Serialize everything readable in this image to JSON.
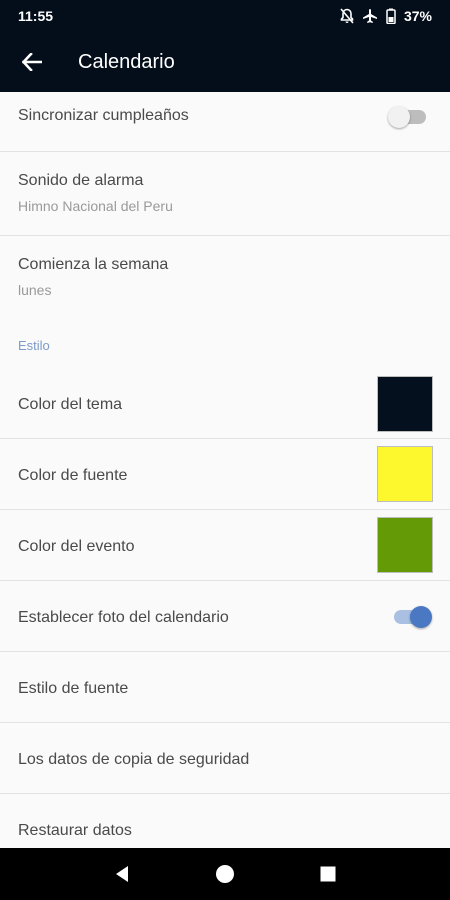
{
  "status_bar": {
    "time": "11:55",
    "battery": "37%",
    "icons": [
      "notifications-off-icon",
      "airplane-mode-icon",
      "battery-icon"
    ]
  },
  "app_bar": {
    "back_icon": "arrow-back-icon",
    "title": "Calendario",
    "background": "#040e1b"
  },
  "settings": {
    "sync_birthdays": {
      "label": "Sincronizar cumpleaños",
      "enabled": false
    },
    "alarm_sound": {
      "label": "Sonido de alarma",
      "value": "Himno Nacional del Peru"
    },
    "week_start": {
      "label": "Comienza la semana",
      "value": "lunes"
    },
    "style_section": "Estilo",
    "theme_color": {
      "label": "Color del tema",
      "color": "#04101d"
    },
    "font_color": {
      "label": "Color de fuente",
      "color": "#fdf82d"
    },
    "event_color": {
      "label": "Color del evento",
      "color": "#649a06"
    },
    "calendar_photo": {
      "label": "Establecer foto del calendario",
      "enabled": true
    },
    "font_style": {
      "label": "Estilo de fuente"
    },
    "backup": {
      "label": "Los datos de copia de seguridad"
    },
    "restore": {
      "label": "Restaurar datos"
    }
  },
  "nav_bar": {
    "icons": [
      "back-triangle-icon",
      "home-circle-icon",
      "recents-square-icon"
    ]
  },
  "colors": {
    "accent": "#4a78c2",
    "section_header": "#7d9bc9"
  }
}
